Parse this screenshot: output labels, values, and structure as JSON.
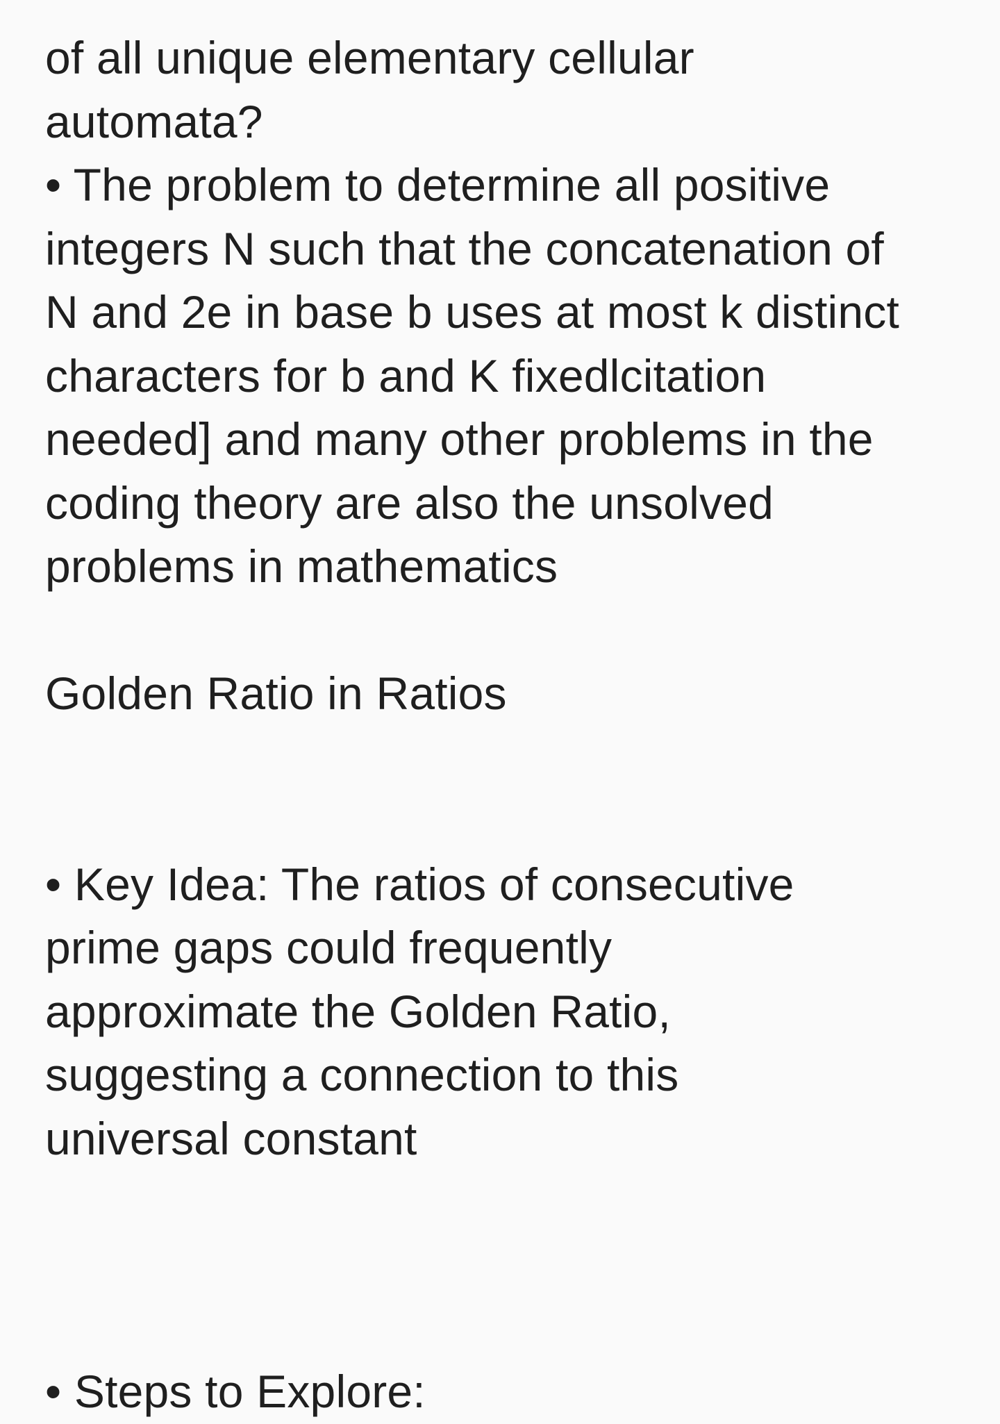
{
  "note": {
    "block1": [
      "of all unique elementary cellular",
      "automata?",
      "• The problem to determine all positive",
      "integers N such that the concatenation of",
      "N and 2e in base b uses at most k distinct",
      "characters for b and K fixedlcitation",
      "needed] and many other problems in the",
      "coding theory are also the unsolved",
      "problems in mathematics"
    ],
    "heading": "Golden Ratio in Ratios",
    "block2": [
      "• Key Idea: The ratios of consecutive",
      "prime gaps could frequently",
      "approximate the Golden Ratio,",
      "suggesting a connection to this",
      "universal constant"
    ],
    "block3": [
      "• Steps to Explore:"
    ]
  }
}
